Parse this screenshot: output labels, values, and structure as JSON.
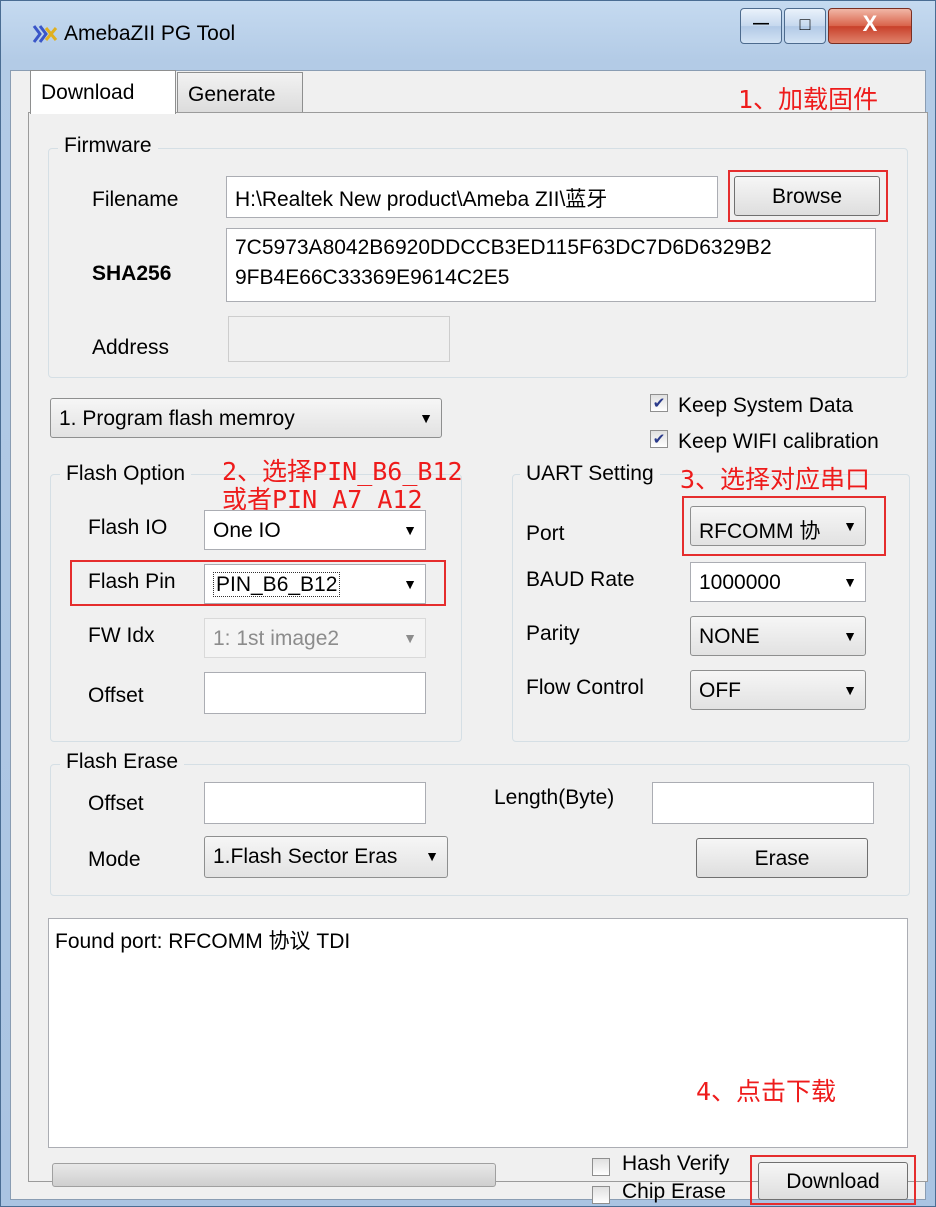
{
  "window": {
    "title": "AmebaZII PG Tool",
    "minimize": "—",
    "maximize": "□",
    "close": "X"
  },
  "tabs": [
    {
      "label": "Download"
    },
    {
      "label": "Generate"
    }
  ],
  "annotations": {
    "step1": "1、加载固件",
    "step2_line1": "2、选择PIN_B6_B12",
    "step2_line2": "或者PIN_A7_A12",
    "step3": "3、选择对应串口",
    "step4": "4、点击下载"
  },
  "firmware": {
    "group_label": "Firmware",
    "filename_label": "Filename",
    "filename_value": "H:\\Realtek New product\\Ameba ZII\\蓝牙",
    "browse_label": "Browse",
    "sha_label": "SHA256",
    "sha_value_line1": "7C5973A8042B6920DDCCB3ED115F63DC7D6D6329B2",
    "sha_value_line2": "9FB4E66C33369E9614C2E5",
    "address_label": "Address",
    "address_value": ""
  },
  "mode_select": {
    "value": "1. Program flash memroy"
  },
  "options": {
    "keep_system_data": "Keep System Data",
    "keep_wifi_calibration": "Keep WIFI calibration"
  },
  "flash_option": {
    "group_label": "Flash Option",
    "io_label": "Flash IO",
    "io_value": "One IO",
    "pin_label": "Flash Pin",
    "pin_value": "PIN_B6_B12",
    "fw_label": "FW Idx",
    "fw_value": "1: 1st image2",
    "offset_label": "Offset",
    "offset_value": ""
  },
  "uart": {
    "group_label": "UART Setting",
    "port_label": "Port",
    "port_value": "RFCOMM 协",
    "baud_label": "BAUD Rate",
    "baud_value": "1000000",
    "parity_label": "Parity",
    "parity_value": "NONE",
    "flow_label": "Flow Control",
    "flow_value": "OFF"
  },
  "flash_erase": {
    "group_label": "Flash Erase",
    "offset_label": "Offset",
    "offset_value": "",
    "length_label": "Length(Byte)",
    "length_value": "",
    "mode_label": "Mode",
    "mode_value": "1.Flash Sector Eras",
    "erase_label": "Erase"
  },
  "log": {
    "text": "Found port: RFCOMM 协议 TDI"
  },
  "bottom": {
    "hash_verify": "Hash Verify",
    "chip_erase": "Chip Erase",
    "download_label": "Download",
    "progress": 0
  }
}
